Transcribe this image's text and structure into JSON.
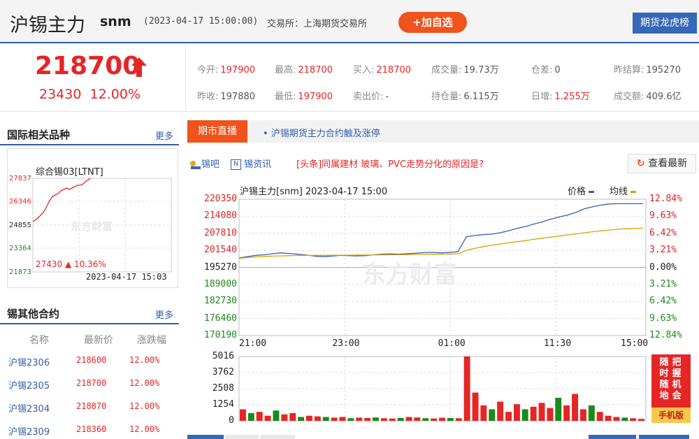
{
  "header": {
    "name": "沪锡主力",
    "code": "snm",
    "time": "(2023-04-17 15:00:00)",
    "exchange": "交易所：上海期货交易所",
    "add_button": "+加自选",
    "lhb_button": "期货龙虎榜"
  },
  "quote": {
    "price": "218700",
    "change": "23430",
    "change_pct": "12.00%",
    "fields": [
      {
        "label": "今开:",
        "value": "197900",
        "color": "red"
      },
      {
        "label": "最高:",
        "value": "218700",
        "color": "red"
      },
      {
        "label": "买入:",
        "value": "218700",
        "color": "red"
      },
      {
        "label": "成交量:",
        "value": "19.73万",
        "color": "neutral"
      },
      {
        "label": "仓差:",
        "value": "0",
        "color": "neutral"
      },
      {
        "label": "昨结算:",
        "value": "195270",
        "color": "neutral"
      },
      {
        "label": "昨收:",
        "value": "197880",
        "color": "neutral"
      },
      {
        "label": "最低:",
        "value": "197900",
        "color": "red"
      },
      {
        "label": "卖出价:",
        "value": "-",
        "color": "neutral"
      },
      {
        "label": "持仓量:",
        "value": "6.115万",
        "color": "neutral"
      },
      {
        "label": "日增:",
        "value": "1.255万",
        "color": "red"
      },
      {
        "label": "成交额:",
        "value": "409.6亿",
        "color": "neutral"
      }
    ]
  },
  "related": {
    "title": "国际相关品种",
    "more": "更多",
    "mini_chart": {
      "title": "综合锡03[LTNT]",
      "y_labels": [
        "27837",
        "26346",
        "24855",
        "23364",
        "21873"
      ],
      "last": "27430",
      "pct": "▲ 10.36%",
      "time": "2023-04-17 15:03",
      "watermark": "东方财富"
    }
  },
  "contracts": {
    "title": "锡其他合约",
    "more": "更多",
    "headers": [
      "名称",
      "最新价",
      "涨跌幅"
    ],
    "rows": [
      {
        "name": "沪锡2306",
        "price": "218600",
        "pct": "12.00%"
      },
      {
        "name": "沪锡2305",
        "price": "218700",
        "pct": "12.00%"
      },
      {
        "name": "沪锡2304",
        "price": "218870",
        "pct": "12.00%"
      },
      {
        "name": "沪锡2309",
        "price": "218360",
        "pct": "12.00%"
      }
    ]
  },
  "live": {
    "tab": "期市直播",
    "news": "• 沪锡期货主力合约触及涨停",
    "links": [
      {
        "label": "锡吧",
        "icon": "chat-icon"
      },
      {
        "label": "锡资讯",
        "icon": "news-icon"
      }
    ],
    "headline": "[头条]同属建材 玻璃、PVC走势分化的原因是?",
    "refresh": "查看最新"
  },
  "chart_data": {
    "type": "line",
    "title": "沪锡主力[snm] 2023-04-17 15:00",
    "legend": [
      "价格",
      "均线"
    ],
    "y_labels": [
      "220350",
      "214080",
      "207810",
      "201540",
      "195270",
      "189000",
      "182730",
      "176460",
      "170190"
    ],
    "pct_labels": [
      "12.84%",
      "9.63%",
      "6.42%",
      "3.21%",
      "0.00%",
      "3.21%",
      "6.42%",
      "9.63%",
      "12.84%"
    ],
    "x_labels": [
      "21:00",
      "23:00",
      "01:00",
      "11:30",
      "15:00"
    ],
    "ylim": [
      170190,
      220350
    ],
    "base": 195270,
    "series": [
      {
        "name": "价格",
        "color": "#3a5ea8",
        "values": [
          198700,
          199200,
          199700,
          199900,
          200300,
          200600,
          200400,
          200100,
          199800,
          199400,
          199200,
          199400,
          199700,
          199600,
          199500,
          199600,
          199900,
          200100,
          200200,
          200100,
          200300,
          200500,
          200700,
          200800,
          200600,
          200800,
          201000,
          206500,
          207000,
          207300,
          207500,
          208000,
          208700,
          209600,
          210300,
          211200,
          212000,
          213000,
          213800,
          214500,
          215500,
          216800,
          217600,
          218200,
          218600,
          218700,
          218700,
          218700,
          218700
        ]
      },
      {
        "name": "均线",
        "color": "#d8a400",
        "values": [
          198600,
          198900,
          199100,
          199300,
          199400,
          199500,
          199600,
          199650,
          199700,
          199700,
          199700,
          199720,
          199750,
          199780,
          199800,
          199820,
          199850,
          199880,
          199900,
          199930,
          199960,
          200000,
          200050,
          200100,
          200150,
          200200,
          200250,
          201500,
          202300,
          202900,
          203400,
          203900,
          204300,
          204700,
          205100,
          205600,
          206000,
          206400,
          206800,
          207200,
          207600,
          208000,
          208400,
          208700,
          209000,
          209300,
          209500,
          209600,
          209700
        ]
      }
    ],
    "volume": {
      "y_labels": [
        "5016",
        "3762",
        "2508",
        "1254",
        "0"
      ],
      "max": 5016,
      "values": [
        900,
        600,
        700,
        400,
        800,
        500,
        600,
        300,
        400,
        350,
        300,
        250,
        300,
        200,
        250,
        220,
        260,
        200,
        180,
        220,
        300,
        260,
        200,
        180,
        240,
        220,
        200,
        5016,
        2200,
        1200,
        900,
        1500,
        700,
        1300,
        900,
        1100,
        1400,
        1000,
        1800,
        1200,
        2100,
        900,
        1200,
        700,
        400,
        300,
        250,
        200,
        150
      ]
    }
  },
  "ad": {
    "cols": [
      "把握机会",
      "随时随地"
    ],
    "footer": "手机版"
  },
  "colors": {
    "up": "#e62525",
    "down": "#1a8a1a",
    "brand_blue": "#2f5da8",
    "orange": "#f0531c"
  }
}
